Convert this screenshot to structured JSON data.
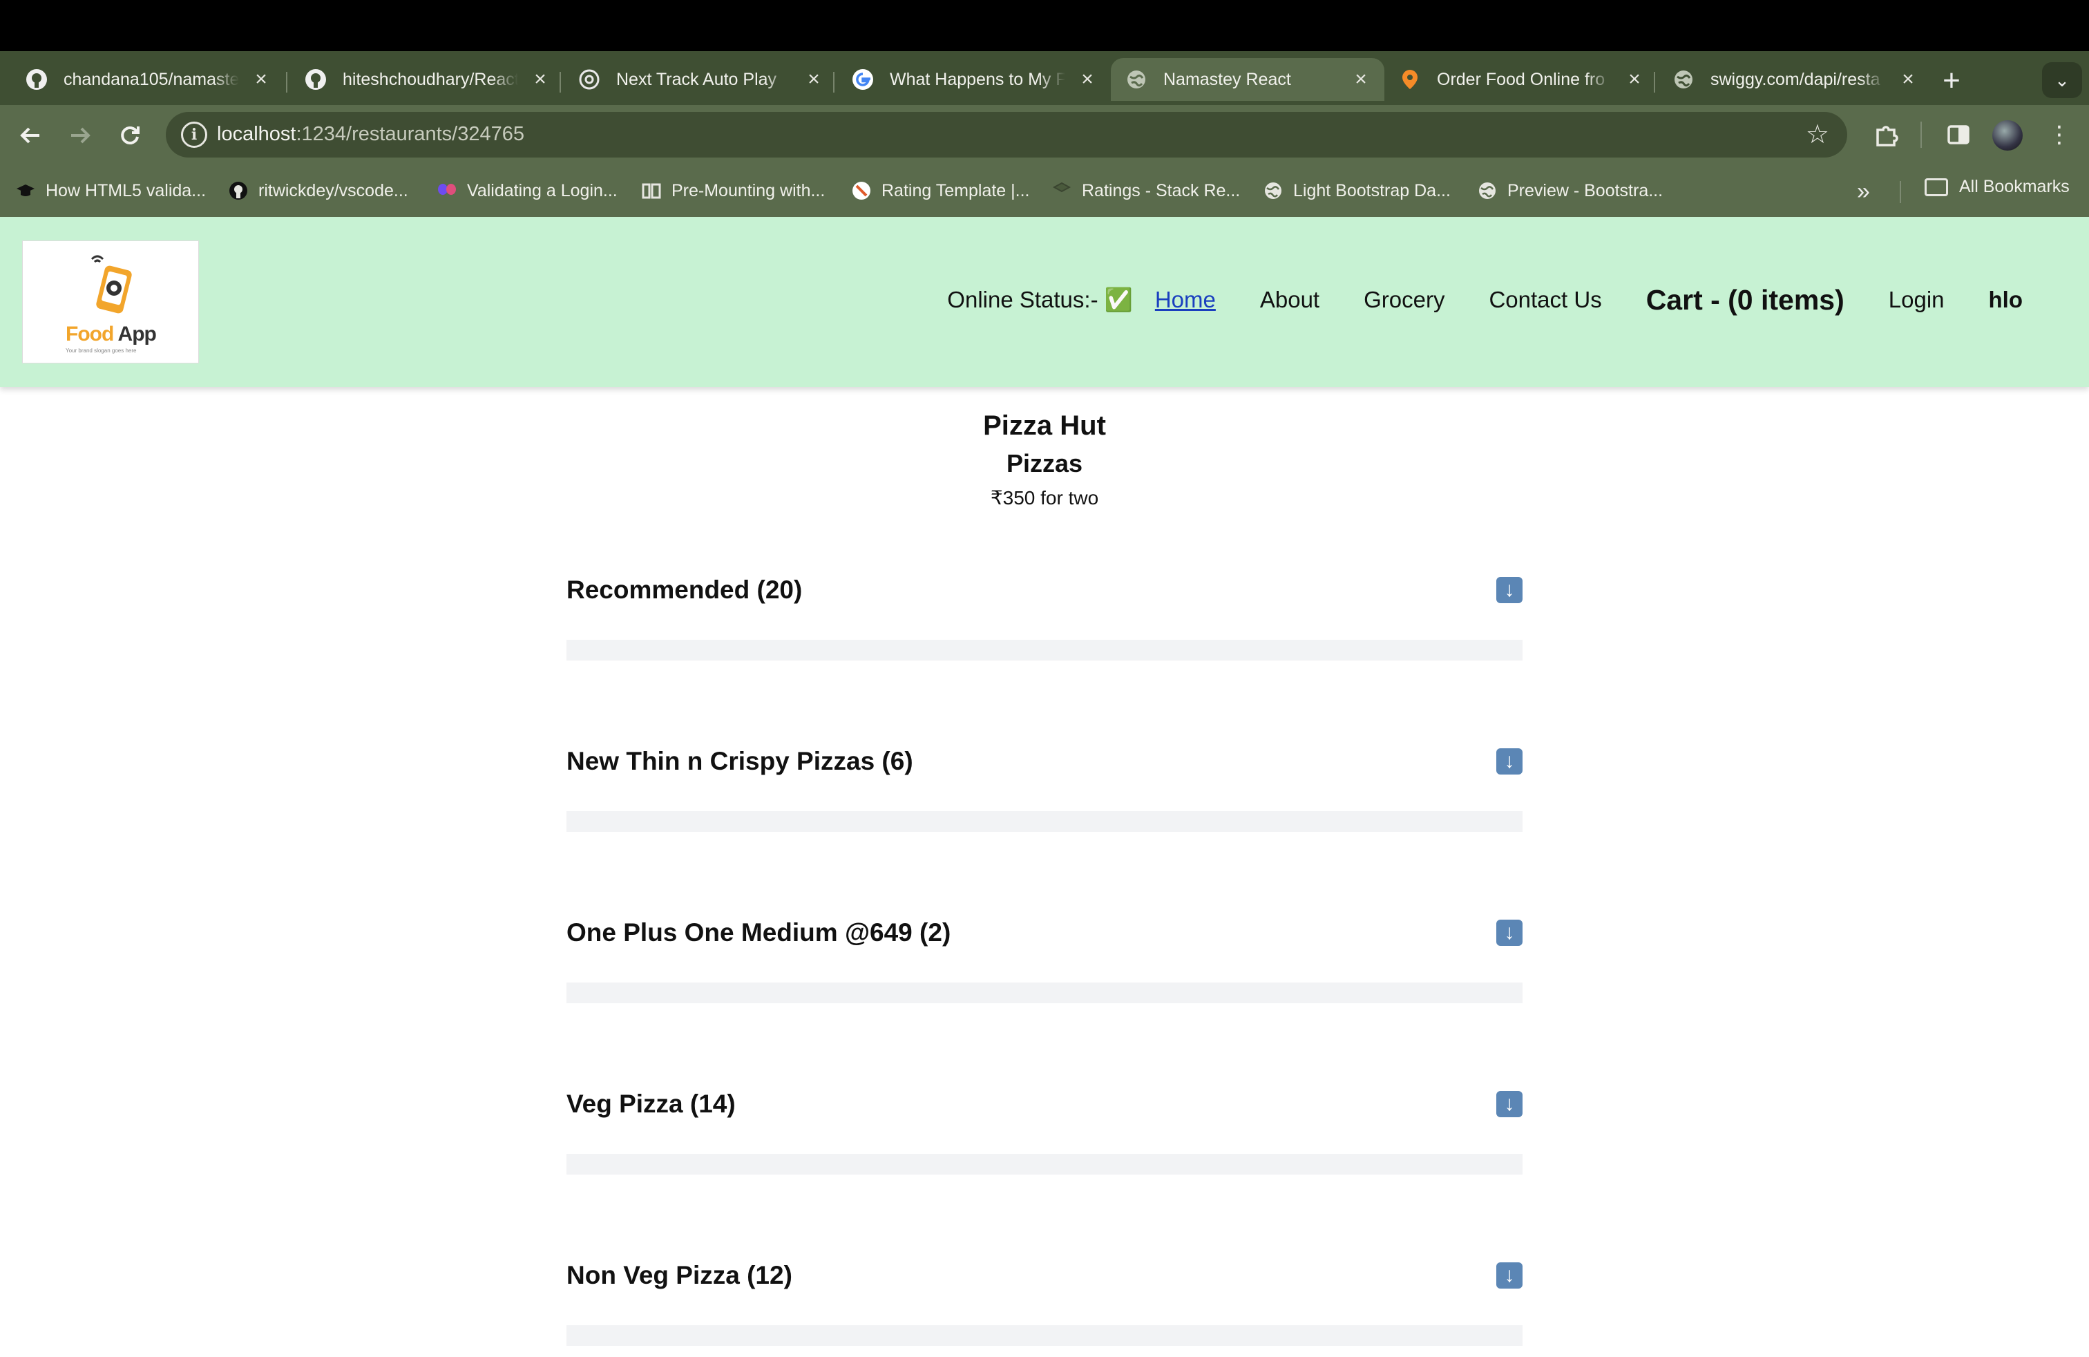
{
  "browser": {
    "tabs": [
      {
        "title": "chandana105/namaste-react",
        "icon": "github-icon"
      },
      {
        "title": "hiteshchoudhary/React",
        "icon": "github-icon"
      },
      {
        "title": "Next Track Auto Play",
        "icon": "chatgpt-icon"
      },
      {
        "title": "What Happens to My F",
        "icon": "google-icon"
      },
      {
        "title": "Namastey React",
        "icon": "globe-icon",
        "active": true
      },
      {
        "title": "Order Food Online fro",
        "icon": "swiggy-icon"
      },
      {
        "title": "swiggy.com/dapi/resta",
        "icon": "globe-icon"
      }
    ],
    "new_tab_label": "+",
    "address": {
      "host": "localhost",
      "path": ":1234/restaurants/324765"
    },
    "bookmarks": [
      {
        "label": "How HTML5 valida...",
        "icon": "graduation-cap-icon"
      },
      {
        "label": "ritwickdey/vscode...",
        "icon": "github-icon"
      },
      {
        "label": "Validating a Login...",
        "icon": "butterfly-icon"
      },
      {
        "label": "Pre-Mounting with...",
        "icon": "book-icon"
      },
      {
        "label": "Rating Template |...",
        "icon": "rating-icon"
      },
      {
        "label": "Ratings - Stack Re...",
        "icon": "stack-icon"
      },
      {
        "label": "Light Bootstrap Da...",
        "icon": "globe-icon"
      },
      {
        "label": "Preview - Bootstra...",
        "icon": "globe-icon"
      }
    ],
    "all_bookmarks_label": "All Bookmarks"
  },
  "header": {
    "logo": {
      "word1": "Food",
      "word2": "App",
      "tagline": "Your brand slogan goes here"
    },
    "nav": {
      "status": "Online Status:- ✅",
      "home": "Home",
      "about": "About",
      "grocery": "Grocery",
      "contact": "Contact Us",
      "cart": "Cart - (0 items)",
      "login": "Login",
      "user": "hlo"
    }
  },
  "restaurant": {
    "name": "Pizza Hut",
    "cuisine": "Pizzas",
    "cost": "₹350 for two"
  },
  "categories": [
    {
      "title": "Recommended (20)"
    },
    {
      "title": "New Thin n Crispy Pizzas (6)"
    },
    {
      "title": "One Plus One Medium @649 (2)"
    },
    {
      "title": "Veg Pizza (14)"
    },
    {
      "title": "Non Veg Pizza (12)"
    }
  ],
  "colors": {
    "header_bg": "#c7f2d3",
    "chrome_bg": "#5a6b4c",
    "link": "#1a3fbf",
    "toggle_icon": "#5b86b5"
  }
}
